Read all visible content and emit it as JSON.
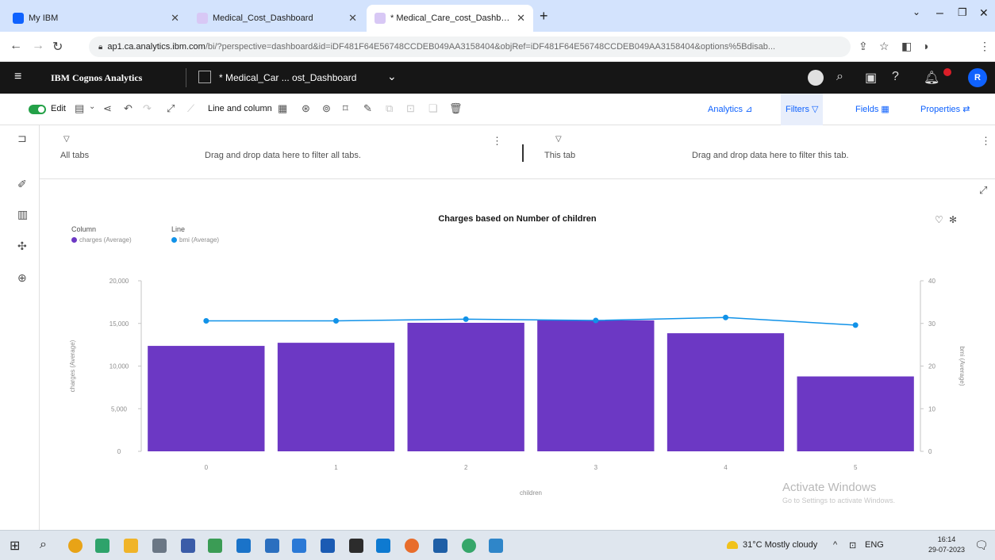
{
  "browser": {
    "tabs": [
      {
        "label": "My IBM",
        "favicon": "ibm-favicon",
        "color": "#0f62fe"
      },
      {
        "label": "Medical_Cost_Dashboard",
        "favicon": "cognos-favicon",
        "color": "#6929c4"
      },
      {
        "label": "* Medical_Care_cost_Dashboard",
        "favicon": "cognos-favicon",
        "color": "#6929c4"
      }
    ],
    "url_host": "ap1.ca.analytics.ibm.com",
    "url_path": "/bi/?perspective=dashboard&id=iDF481F64E56748CCDEB049AA3158404&objRef=iDF481F64E56748CCDEB049AA3158404&options%5Bdisab..."
  },
  "app": {
    "brand": "IBM Cognos Analytics",
    "dashboard_name": "* Medical_Car ... ost_Dashboard",
    "avatar_initial": "R",
    "notification_count": "1"
  },
  "toolbar": {
    "edit_label": "Edit",
    "viz_type_label": "Line and column",
    "analytics_label": "Analytics",
    "filters_label": "Filters",
    "fields_label": "Fields",
    "properties_label": "Properties"
  },
  "filters": {
    "all_tabs_label": "All tabs",
    "all_tabs_hint": "Drag and drop data here to filter all tabs.",
    "this_tab_label": "This tab",
    "this_tab_hint": "Drag and drop data here to filter this tab."
  },
  "legend": {
    "column_heading": "Column",
    "line_heading": "Line"
  },
  "watermark": {
    "line1": "Activate Windows",
    "line2": "Go to Settings to activate Windows."
  },
  "taskbar": {
    "weather": "31°C  Mostly cloudy",
    "lang": "ENG",
    "time": "16:14",
    "date": "29-07-2023"
  },
  "chart_data": {
    "type": "bar",
    "title": "Charges based on Number of children",
    "xlabel": "children",
    "ylabel": "charges (Average)",
    "y2label": "bmi (Average)",
    "categories": [
      "0",
      "1",
      "2",
      "3",
      "4",
      "5"
    ],
    "series": [
      {
        "name": "charges (Average)",
        "type": "bar",
        "axis": "left",
        "color": "#6c38c4",
        "values": [
          12366,
          12731,
          15074,
          15355,
          13851,
          8786
        ]
      },
      {
        "name": "bmi (Average)",
        "type": "line",
        "axis": "right",
        "color": "#1192e8",
        "values": [
          30.6,
          30.6,
          31.0,
          30.7,
          31.4,
          29.6
        ]
      }
    ],
    "ylim": [
      0,
      20000
    ],
    "y_ticks": [
      "0",
      "5,000",
      "10,000",
      "15,000",
      "20,000"
    ],
    "y2lim": [
      0,
      40
    ],
    "y2_ticks": [
      "0",
      "10",
      "20",
      "30",
      "40"
    ],
    "grid": false,
    "legend_position": "top-left"
  }
}
